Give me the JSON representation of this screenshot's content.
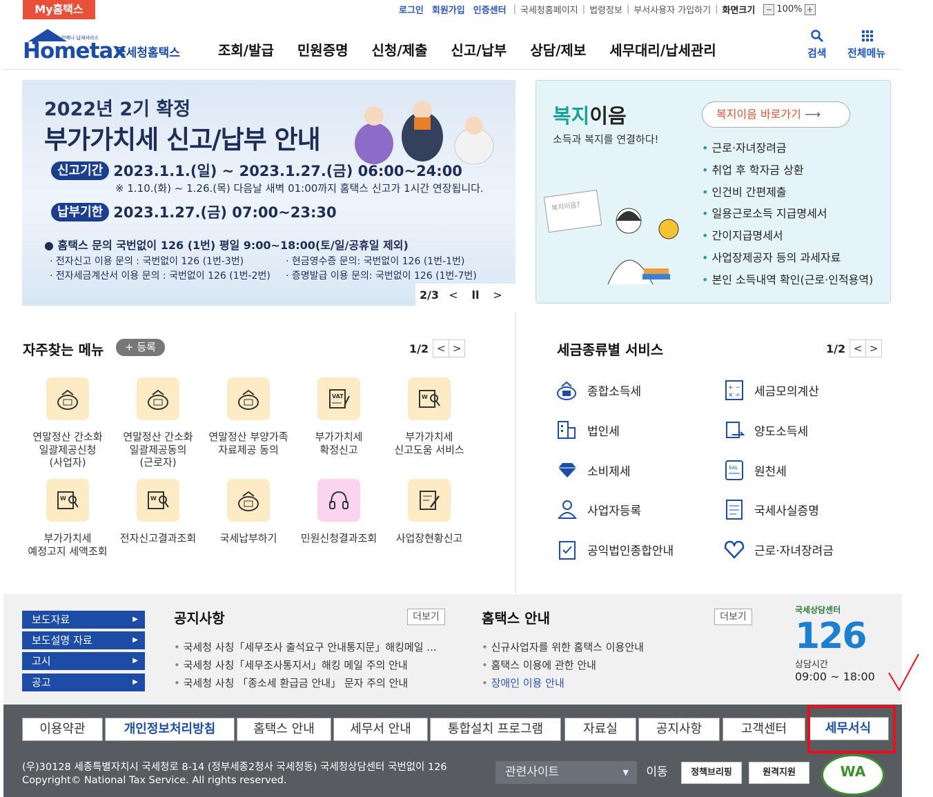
{
  "topbar": {
    "my_hometax": "My홈택스",
    "login": "로그인",
    "signup": "회원가입",
    "cert_center": "인증센터",
    "links": [
      "국세청홈페이지",
      "법령정보",
      "부서사용자 가입하기"
    ],
    "screen_size_label": "화면크기",
    "zoom_minus": "−",
    "zoom_value": "100%",
    "zoom_plus": "+"
  },
  "header": {
    "logo_small": "언제나 납세서비스",
    "logo_text": "Hometax",
    "logo_sub": "국세청홈택스",
    "nav": [
      "조회/발급",
      "민원증명",
      "신청/제출",
      "신고/납부",
      "상담/제보",
      "세무대리/납세관리"
    ],
    "search_label": "검색",
    "all_menu_label": "전체메뉴"
  },
  "banner": {
    "subtitle": "2022년 2기 확정",
    "title": "부가가치세 신고/납부 안내",
    "period_tag": "신고기간",
    "period_value": "2023.1.1.(일) ~ 2023.1.27.(금) 06:00~24:00",
    "period_note": "※ 1.10.(화) ~ 1.26.(목) 다음날 새벽 01:00까지 홈택스 신고가 1시간 연장됩니다.",
    "pay_tag": "납부기한",
    "pay_value": "2023.1.27.(금) 07:00~23:30",
    "inquiry": "홈택스 문의 국번없이 126 (1번) 평일 9:00~18:00(토/일/공휴일 제외)",
    "inq1": "· 전자신고 이용 문의 : 국번없이 126 (1번-3번)",
    "inq2": "· 현금영수증 문의: 국번없이 126 (1번-1번)",
    "inq3": "· 전자세금계산서 이용 문의 : 국번없이 126 (1번-2번)",
    "inq4": "· 증명발급 이용 문의: 국번없이 126 (1번-7번)",
    "page": "2/3"
  },
  "welfare": {
    "title_green": "복지",
    "title_black": "이음",
    "subtitle": "소득과 복지를 연결하다!",
    "button": "복지이음 바로가기",
    "items": [
      "근로·자녀장려금",
      "취업 후 학자금 상환",
      "인건비 간편제출",
      "일용근로소득 지급명세서",
      "간이지급명세서",
      "사업장제공자 등의 과세자료",
      "본인 소득내역 확인(근로·인적용역)"
    ],
    "illus_label": "복지이음?"
  },
  "frequent": {
    "title": "자주찾는 메뉴",
    "register": "+ 등록",
    "page": "1/2",
    "items": [
      {
        "label": "연말정산 간소화\n일괄제공신청\n(사업자)",
        "icon": "money-bag-icon"
      },
      {
        "label": "연말정산 간소화\n일괄제공동의\n(근로자)",
        "icon": "money-bag-icon"
      },
      {
        "label": "연말정산 부양가족\n자료제공 동의",
        "icon": "money-bag-icon"
      },
      {
        "label": "부가가치세\n확정신고",
        "icon": "vat-doc-icon"
      },
      {
        "label": "부가가치세\n신고도움 서비스",
        "icon": "search-doc-icon"
      },
      {
        "label": "부가가치세\n예정고지 세액조회",
        "icon": "search-doc-icon"
      },
      {
        "label": "전자신고결과조회",
        "icon": "search-doc-icon"
      },
      {
        "label": "국세납부하기",
        "icon": "money-bag-icon"
      },
      {
        "label": "민원신청결과조회",
        "icon": "headset-icon"
      },
      {
        "label": "사업장현황신고",
        "icon": "edit-doc-icon"
      }
    ]
  },
  "taxservice": {
    "title": "세금종류별 서비스",
    "page": "1/2",
    "left": [
      "종합소득세",
      "법인세",
      "소비제세",
      "사업자등록",
      "공익법인종합안내"
    ],
    "right": [
      "세금모의계산",
      "양도소득세",
      "원천세",
      "국세사실증명",
      "근로·자녀장려금"
    ]
  },
  "sidebar": [
    "보도자료",
    "보도설명 자료",
    "고시",
    "공고"
  ],
  "notice": {
    "title": "공지사항",
    "more": "더보기",
    "items": [
      "국세청 사칭「세무조사 출석요구 안내통지문」해킹메일 ...",
      "국세청 사칭「세무조사통지서」해킹 메일 주의 안내",
      "국세청 사칭 「종소세 환급금 안내」 문자 주의 안내"
    ]
  },
  "guide": {
    "title": "홈택스 안내",
    "more": "더보기",
    "items": [
      "신규사업자를 위한 홈택스 이용안내",
      "홈택스 이용에 관한 안내",
      "장애인 이용 안내"
    ]
  },
  "callcenter": {
    "top": "국세상담센터",
    "number": "126",
    "hours_label": "상담시간",
    "hours": "09:00 ~ 18:00"
  },
  "footer": {
    "buttons": [
      "이용약관",
      "개인정보처리방침",
      "홈택스 안내",
      "세무서 안내",
      "통합설치 프로그램",
      "자료실",
      "공지사항",
      "고객센터",
      "세무서식"
    ],
    "address": "(우)30128 세종특별자치시 국세청로 8-14 (정부세종2청사 국세청동) 국세청상담센터 국번없이 126",
    "copyright": "Copyright© National Tax Service. All rights reserved.",
    "related": "관련사이트",
    "go": "이동",
    "policy": "정책브리핑",
    "remote": "원격지원",
    "wa": "WA"
  },
  "colors": {
    "brand_blue": "#1c4ca5",
    "accent_red": "#e8503a",
    "highlight": "#e8101c"
  }
}
